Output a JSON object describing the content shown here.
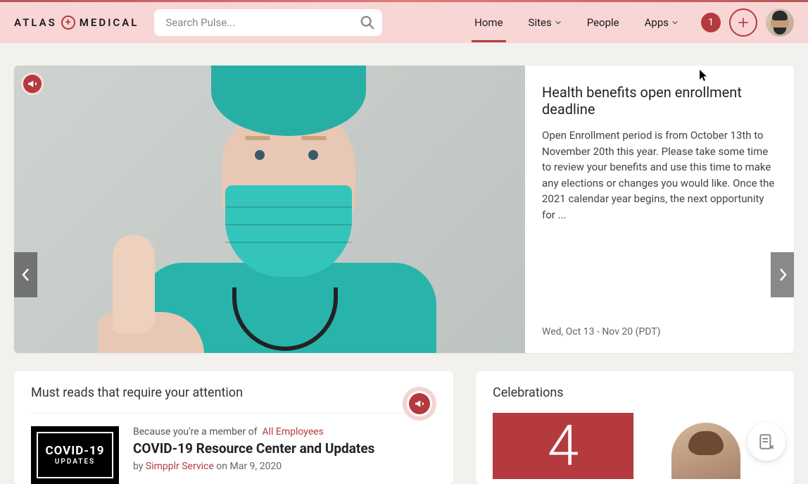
{
  "brand": {
    "left": "ATLAS",
    "right": "MEDICAL"
  },
  "search": {
    "placeholder": "Search Pulse..."
  },
  "nav": {
    "home": "Home",
    "sites": "Sites",
    "people": "People",
    "apps": "Apps"
  },
  "notif_count": "1",
  "hero": {
    "title": "Health benefits open enrollment deadline",
    "description": "Open Enrollment period is from October 13th to November 20th this year. Please take some time to review your benefits and use this time to make any elections or changes you would like. Once the 2021 calendar year begins, the next opportunity for ...",
    "date": "Wed, Oct 13 - Nov 20 (PDT)"
  },
  "must": {
    "section_title": "Must reads that require your attention",
    "member_prefix": "Because you're a member of",
    "member_link": "All Employees",
    "item_title": "COVID-19 Resource Center and Updates",
    "by_prefix": "by",
    "author": "Simpplr Service",
    "on_prefix": "on",
    "item_date": "Mar 9, 2020",
    "thumb_line1": "COVID-19",
    "thumb_line2": "UPDATES"
  },
  "celebrations": {
    "section_title": "Celebrations",
    "big_number": "4"
  }
}
